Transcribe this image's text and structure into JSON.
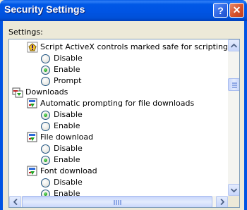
{
  "window": {
    "title": "Security Settings",
    "help_label": "?",
    "close_label": "✕"
  },
  "settings_label": "Settings:",
  "list": [
    {
      "kind": "setting",
      "label": "Script ActiveX controls marked safe for scripting",
      "icon": "warning-setting-icon"
    },
    {
      "kind": "option",
      "label": "Disable",
      "selected": false
    },
    {
      "kind": "option",
      "label": "Enable",
      "selected": true
    },
    {
      "kind": "option",
      "label": "Prompt",
      "selected": false
    },
    {
      "kind": "category",
      "label": "Downloads",
      "icon": "downloads-category-icon"
    },
    {
      "kind": "setting",
      "label": "Automatic prompting for file downloads",
      "icon": "download-setting-icon"
    },
    {
      "kind": "option",
      "label": "Disable",
      "selected": true
    },
    {
      "kind": "option",
      "label": "Enable",
      "selected": false
    },
    {
      "kind": "setting",
      "label": "File download",
      "icon": "download-setting-icon"
    },
    {
      "kind": "option",
      "label": "Disable",
      "selected": false
    },
    {
      "kind": "option",
      "label": "Enable",
      "selected": true
    },
    {
      "kind": "setting",
      "label": "Font download",
      "icon": "download-setting-icon"
    },
    {
      "kind": "option",
      "label": "Disable",
      "selected": false
    },
    {
      "kind": "option",
      "label": "Enable",
      "selected": true
    }
  ],
  "colors": {
    "titlebar": "#0054e3",
    "radio_selected": "#21a121",
    "list_border": "#7f9db9"
  }
}
